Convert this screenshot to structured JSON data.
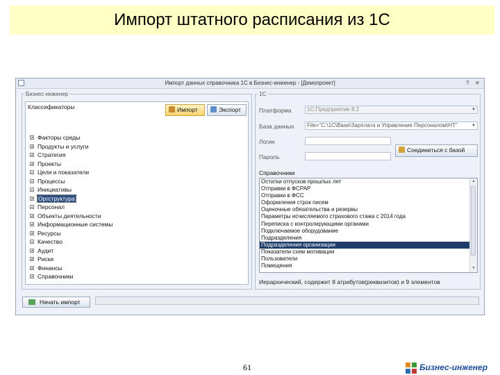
{
  "slide": {
    "title": "Импорт штатного расписания из 1С",
    "page_number": "61",
    "logo_text": "Бизнес-инженер"
  },
  "window": {
    "title": "Импорт данных справочника 1С в Бизнес-инженер - [Демопроект]",
    "close_glyph": "✕",
    "help_glyph": "?"
  },
  "left_panel": {
    "group_label": "Бизнес-инженер",
    "tree_header": "Классификаторы",
    "import_label": "Импорт",
    "export_label": "Экспорт",
    "items": [
      {
        "label": "Факторы среды",
        "exp": "plus"
      },
      {
        "label": "Продукты и услуги",
        "exp": "plus"
      },
      {
        "label": "Стратегия",
        "exp": "plus"
      },
      {
        "label": "Проекты",
        "exp": "plus"
      },
      {
        "label": "Цели и показатели",
        "exp": "minus"
      },
      {
        "label": "Процессы",
        "exp": "minus"
      },
      {
        "label": "Инициативы",
        "exp": "minus"
      },
      {
        "label": "Оргструктура",
        "exp": "plus",
        "selected": true
      },
      {
        "label": "Персонал",
        "exp": "minus"
      },
      {
        "label": "Объекты деятельности",
        "exp": "plus"
      },
      {
        "label": "Информационные системы",
        "exp": "plus"
      },
      {
        "label": "Ресурсы",
        "exp": "plus"
      },
      {
        "label": "Качество",
        "exp": "minus"
      },
      {
        "label": "Аудит",
        "exp": "plus"
      },
      {
        "label": "Риски",
        "exp": "plus"
      },
      {
        "label": "Финансы",
        "exp": "plus"
      },
      {
        "label": "Справочники",
        "exp": "plus"
      }
    ]
  },
  "right_panel": {
    "group_label": "1С",
    "platform_label": "Платформа",
    "platform_value": "1С:Предприятие 8.2",
    "db_label": "База данных",
    "db_value": "File=\"C:\\1C\\Base\\Зарплата и Управление Персоналом\\НТ\"",
    "login_label": "Логин",
    "login_value": "",
    "password_label": "Пароль",
    "password_value": "",
    "connect_label": "Соединиться с базой",
    "dictionaries_label": "Справочники",
    "dictionaries": [
      "Остатки отпусков прошлых лет",
      "Отправки в ФСРАР",
      "Отправки в ФСС",
      "Оформления строк писем",
      "Оценочные обязательства и резервы",
      "Параметры исчисляемого страхового стажа с 2014 года",
      "Переписка с контролирующими органами",
      "Подключаемое оборудование",
      "Подразделения",
      "Подразделения организации",
      "Показатели схем мотивации",
      "Пользователи",
      "Помещения"
    ],
    "selected_index": 9,
    "status_text": "Иерархический, содержит 8 атрибутов(реквизитов) и 9 элементов"
  },
  "footer": {
    "start_label": "Начать импорт"
  },
  "colors": {
    "title_bg": "#ffffc6",
    "selection": "#1f3d6b",
    "logo": "#1f4f9a"
  }
}
